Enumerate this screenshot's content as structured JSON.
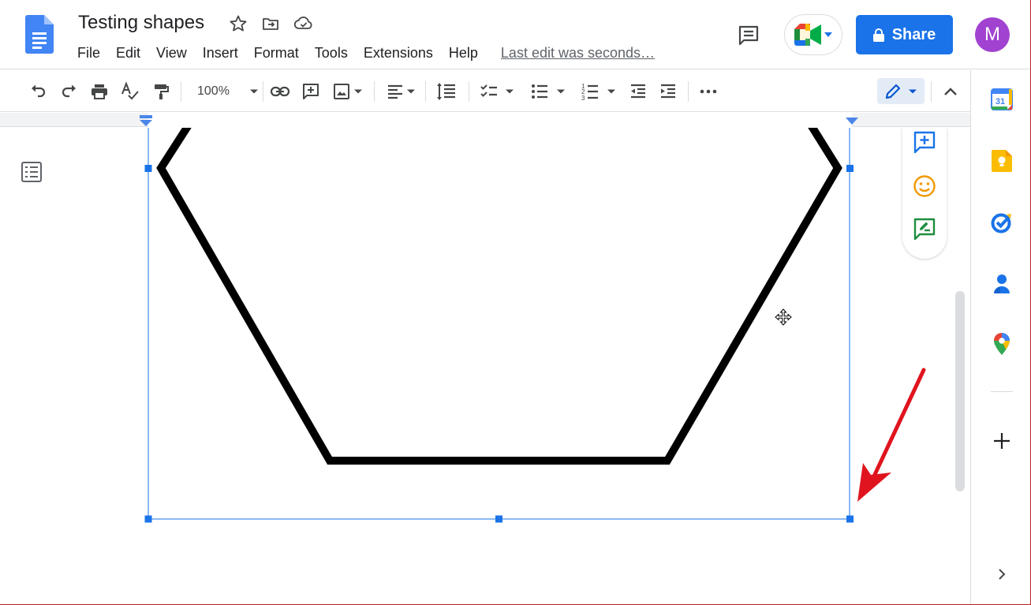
{
  "document": {
    "title": "Testing shapes",
    "last_edit": "Last edit was seconds…"
  },
  "menu": [
    "File",
    "Edit",
    "View",
    "Insert",
    "Format",
    "Tools",
    "Extensions",
    "Help"
  ],
  "header": {
    "share_label": "Share",
    "avatar_initial": "M"
  },
  "toolbar": {
    "zoom": "100%"
  },
  "colors": {
    "share_blue": "#1a73e8",
    "avatar_purple": "#a142d1",
    "selection_blue": "#1a73e8",
    "annotation_arrow": "#e0141e",
    "shape_stroke": "#000000"
  },
  "icons": {
    "header": [
      "docs-logo-icon",
      "star-icon",
      "move-to-folder-icon",
      "cloud-saved-icon",
      "comment-history-icon",
      "google-meet-icon",
      "lock-icon"
    ],
    "toolbar": [
      "undo-icon",
      "redo-icon",
      "print-icon",
      "spellcheck-icon",
      "paint-format-icon",
      "link-icon",
      "add-comment-icon",
      "insert-image-icon",
      "align-icon",
      "line-spacing-icon",
      "checklist-icon",
      "bulleted-list-icon",
      "numbered-list-icon",
      "decrease-indent-icon",
      "increase-indent-icon",
      "more-icon",
      "editing-mode-icon",
      "collapse-icon"
    ],
    "side_panel": [
      "calendar-icon",
      "keep-icon",
      "tasks-icon",
      "contacts-icon",
      "maps-icon",
      "add-icon",
      "expand-panel-icon"
    ]
  },
  "calendar_day": "31"
}
